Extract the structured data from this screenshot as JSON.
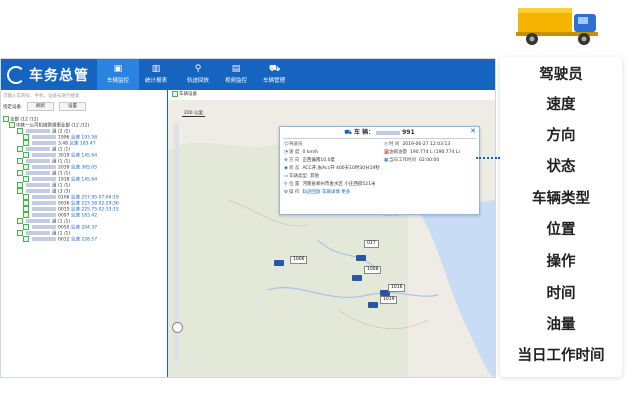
{
  "app": {
    "logo_text": "车务总管"
  },
  "nav": {
    "tabs": [
      {
        "label": "车辆监控"
      },
      {
        "label": "统计报表"
      },
      {
        "label": "轨迹回放"
      },
      {
        "label": "视频监控"
      },
      {
        "label": "车辆管理"
      }
    ]
  },
  "left": {
    "search_placeholder": "可输入车牌号、手机、设备号进行搜索",
    "tools": [
      "指定设备",
      "刷新",
      "设置"
    ],
    "tree": [
      {
        "text": "全部 (12 /12)"
      },
      {
        "text": "中铁一公司机械管理事业部 (12 /12)"
      },
      {
        "text": "组 (2 /2)"
      },
      {
        "text": "1996",
        "status": "怠速",
        "speed": "193.58"
      },
      {
        "text": "3.48",
        "status": "怠速",
        "speed": "183.47"
      },
      {
        "text": "组 (1 /1)"
      },
      {
        "text": "3019",
        "status": "怠速",
        "speed": "145.64"
      },
      {
        "text": "组 (1 /1)"
      },
      {
        "text": "2039",
        "status": "怠速",
        "speed": "365.05"
      },
      {
        "text": "组 (1 /1)"
      },
      {
        "text": "1918",
        "status": "怠速",
        "speed": "145.64"
      },
      {
        "text": "组 (1 /1)"
      },
      {
        "text": "组 (3 /3)"
      },
      {
        "text": "0106",
        "status": "怠速",
        "speed": "257.95",
        "time": "07:04:19"
      },
      {
        "text": "0036",
        "status": "怠速",
        "speed": "223.58",
        "time": "02:29:36"
      },
      {
        "text": "0015",
        "status": "怠速",
        "speed": "225.75",
        "time": "02:33:15"
      },
      {
        "text": "0097",
        "status": "怠速",
        "speed": "183.42"
      },
      {
        "text": "组 (1 /1)"
      },
      {
        "text": "0050",
        "status": "怠速",
        "speed": "204.37"
      },
      {
        "text": "组 (1 /1)"
      },
      {
        "text": "0012",
        "status": "怠速",
        "speed": "228.57"
      }
    ]
  },
  "map": {
    "header_label": "车辆设备",
    "scale_label": "200 公里",
    "markers": [
      "1006",
      "017",
      "1008",
      "1016",
      "1019"
    ]
  },
  "popup": {
    "title": "车 辆：",
    "plate_tail": "991",
    "fields": {
      "driver_k": "驾驶员",
      "driver_v": "",
      "time_k": "时 间",
      "time_v": "2019-06-27 12:03:13",
      "speed_k": "速 度",
      "speed_v": "0 km/h",
      "oil_k": "油箱油量",
      "oil_v": "190.774 L (190.774 L)",
      "dir_k": "方 向",
      "dir_v": "正西偏南10.0度",
      "work_k": "当日工作时间",
      "work_v": "02:00:00",
      "state_k": "状 态",
      "state_v": "ACC开,省Acc开 400天10时30分19秒",
      "type_k": "车辆类型",
      "type_v": "其他",
      "pos_k": "位 置",
      "pos_v": "河南省郑州市金水区 小庄西街521米",
      "op_k": "操 作",
      "op_v": "轨迹回放   车辆详情   更多"
    }
  },
  "feature_list": [
    "驾驶员",
    "速度",
    "方向",
    "状态",
    "车辆类型",
    "位置",
    "操作",
    "时间",
    "油量",
    "当日工作时间"
  ],
  "colors": {
    "brand": "#1565c0",
    "accent": "#2b83e0",
    "truck_body": "#f5b400",
    "truck_cab": "#2f6fd1"
  }
}
